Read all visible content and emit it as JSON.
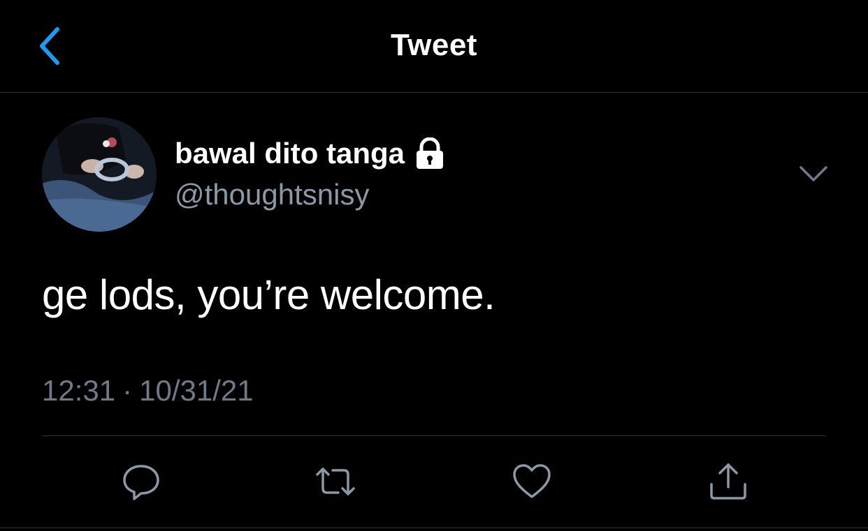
{
  "header": {
    "title": "Tweet",
    "back_icon": "chevron-left-icon"
  },
  "author": {
    "display_name": "bawal dito tanga",
    "handle": "@thoughtsnisy",
    "protected_icon": "lock-icon"
  },
  "tweet": {
    "text": "ge lods, you’re welcome.",
    "time": "12:31",
    "separator": "·",
    "date": "10/31/21"
  },
  "actions": [
    "reply-icon",
    "retweet-icon",
    "like-icon",
    "share-icon"
  ],
  "colors": {
    "background": "#000000",
    "accent": "#1d9bf0",
    "secondary_text": "#8b98a5",
    "divider": "#2f3336"
  }
}
